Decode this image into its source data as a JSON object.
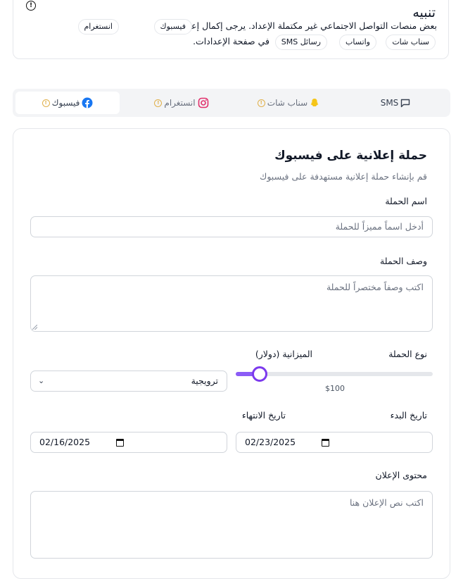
{
  "alert": {
    "title": "تنبيه",
    "message": "بعض منصات التواصل الاجتماعي غير مكتملة الإعداد. يرجى إكمال إعداد:",
    "platforms_row1": [
      "فيسبوك",
      "انستغرام"
    ],
    "platforms_row2": [
      "سناب شات",
      "واتساب",
      "رسائل SMS"
    ],
    "message_end": "في صفحة الإعدادات."
  },
  "tabs": [
    {
      "label": "SMS",
      "icon": "message-icon",
      "warning": false,
      "active": false
    },
    {
      "label": "سناب شات",
      "icon": "snapchat-icon",
      "warning": true,
      "active": false
    },
    {
      "label": "انستغرام",
      "icon": "instagram-icon",
      "warning": true,
      "active": false
    },
    {
      "label": "فيسبوك",
      "icon": "facebook-icon",
      "warning": true,
      "active": true
    }
  ],
  "form": {
    "title": "حملة إعلانية على فيسبوك",
    "subtitle": "قم بإنشاء حملة إعلانية مستهدفة على فيسبوك",
    "name_label": "اسم الحملة",
    "name_placeholder": "أدخل اسماً مميزاً للحملة",
    "desc_label": "وصف الحملة",
    "desc_placeholder": "اكتب وصفاً مختصراً للحملة",
    "type_label": "نوع الحملة",
    "type_value": "ترويجية",
    "budget_label": "الميزانية (دولار)",
    "budget_value": "$100",
    "budget_fraction": 0.12,
    "start_label": "تاريخ البدء",
    "start_value": "02/16/2025",
    "end_label": "تاريخ الانتهاء",
    "end_value": "02/23/2025",
    "content_label": "محتوى الإعلان",
    "content_placeholder": "اكتب نص الإعلان هنا"
  },
  "colors": {
    "accent": "#7c3aed",
    "facebook": "#1877f2",
    "instagram": "#e1306c",
    "snapchat": "#f5c518",
    "warning": "#e0b04b"
  }
}
